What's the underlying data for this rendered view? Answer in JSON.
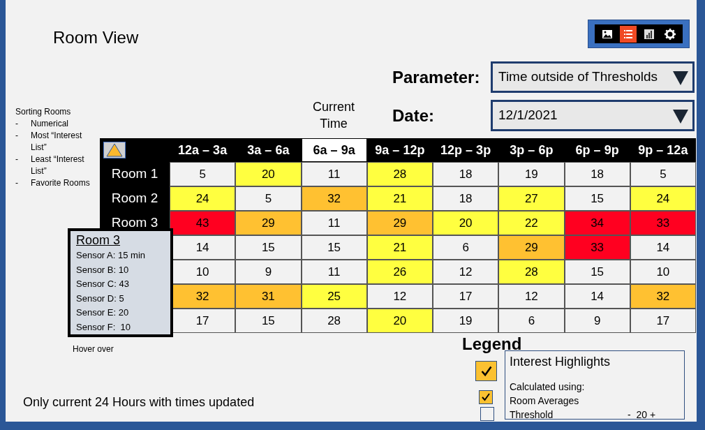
{
  "page_title": "Room View",
  "toolbar": [
    {
      "kind": "image",
      "selected": false
    },
    {
      "kind": "list",
      "selected": true
    },
    {
      "kind": "chart",
      "selected": false
    },
    {
      "kind": "settings",
      "selected": false
    }
  ],
  "parameter": {
    "label": "Parameter:",
    "value": "Time outside of Thresholds"
  },
  "date": {
    "label": "Date:",
    "value": "12/1/2021"
  },
  "current_time_label": "Current Time",
  "sorting": {
    "title": "Sorting Rooms",
    "bullet": "-",
    "options": [
      "Numerical",
      "Most “Interest List”",
      "Least “Interest List”",
      "Favorite Rooms"
    ]
  },
  "table": {
    "columns": [
      {
        "label": "12a – 3a",
        "selected": false
      },
      {
        "label": "3a – 6a",
        "selected": false
      },
      {
        "label": "6a – 9a",
        "selected": true
      },
      {
        "label": "9a – 12p",
        "selected": false
      },
      {
        "label": "12p – 3p",
        "selected": false
      },
      {
        "label": "3p – 6p",
        "selected": false
      },
      {
        "label": "6p – 9p",
        "selected": false
      },
      {
        "label": "9p – 12a",
        "selected": false
      }
    ],
    "rows": [
      {
        "label": "Room 1",
        "cells": [
          {
            "value": "5",
            "color": "#f2f2f2"
          },
          {
            "value": "20",
            "color": "#ffff40"
          },
          {
            "value": "11",
            "color": "#f2f2f2"
          },
          {
            "value": "28",
            "color": "#ffff40"
          },
          {
            "value": "18",
            "color": "#f2f2f2"
          },
          {
            "value": "19",
            "color": "#f2f2f2"
          },
          {
            "value": "18",
            "color": "#f2f2f2"
          },
          {
            "value": "5",
            "color": "#f2f2f2"
          }
        ]
      },
      {
        "label": "Room 2",
        "cells": [
          {
            "value": "24",
            "color": "#ffff40"
          },
          {
            "value": "5",
            "color": "#f2f2f2"
          },
          {
            "value": "32",
            "color": "#ffc131"
          },
          {
            "value": "21",
            "color": "#ffff40"
          },
          {
            "value": "18",
            "color": "#f2f2f2"
          },
          {
            "value": "27",
            "color": "#ffff40"
          },
          {
            "value": "15",
            "color": "#f2f2f2"
          },
          {
            "value": "24",
            "color": "#ffff40"
          }
        ]
      },
      {
        "label": "Room 3",
        "cells": [
          {
            "value": "43",
            "color": "#ff0020"
          },
          {
            "value": "29",
            "color": "#ffc131"
          },
          {
            "value": "11",
            "color": "#f2f2f2"
          },
          {
            "value": "29",
            "color": "#ffc131"
          },
          {
            "value": "20",
            "color": "#ffff40"
          },
          {
            "value": "22",
            "color": "#ffff40"
          },
          {
            "value": "34",
            "color": "#ff0020"
          },
          {
            "value": "33",
            "color": "#ff0020"
          }
        ]
      },
      {
        "cells": [
          {
            "value": "14",
            "color": "#f2f2f2"
          },
          {
            "value": "15",
            "color": "#f2f2f2"
          },
          {
            "value": "15",
            "color": "#f2f2f2"
          },
          {
            "value": "21",
            "color": "#ffff40"
          },
          {
            "value": "6",
            "color": "#f2f2f2"
          },
          {
            "value": "29",
            "color": "#ffc131"
          },
          {
            "value": "33",
            "color": "#ff0020"
          },
          {
            "value": "14",
            "color": "#f2f2f2"
          }
        ]
      },
      {
        "cells": [
          {
            "value": "10",
            "color": "#f2f2f2"
          },
          {
            "value": "9",
            "color": "#f2f2f2"
          },
          {
            "value": "11",
            "color": "#f2f2f2"
          },
          {
            "value": "26",
            "color": "#ffff40"
          },
          {
            "value": "12",
            "color": "#f2f2f2"
          },
          {
            "value": "28",
            "color": "#ffff40"
          },
          {
            "value": "15",
            "color": "#f2f2f2"
          },
          {
            "value": "10",
            "color": "#f2f2f2"
          }
        ]
      },
      {
        "cells": [
          {
            "value": "32",
            "color": "#ffc131"
          },
          {
            "value": "31",
            "color": "#ffc131"
          },
          {
            "value": "25",
            "color": "#ffff40"
          },
          {
            "value": "12",
            "color": "#f2f2f2"
          },
          {
            "value": "17",
            "color": "#f2f2f2"
          },
          {
            "value": "12",
            "color": "#f2f2f2"
          },
          {
            "value": "14",
            "color": "#f2f2f2"
          },
          {
            "value": "32",
            "color": "#ffc131"
          }
        ]
      },
      {
        "cells": [
          {
            "value": "17",
            "color": "#f2f2f2"
          },
          {
            "value": "15",
            "color": "#f2f2f2"
          },
          {
            "value": "28",
            "color": "#f2f2f2"
          },
          {
            "value": "20",
            "color": "#ffff40"
          },
          {
            "value": "19",
            "color": "#f2f2f2"
          },
          {
            "value": "6",
            "color": "#f2f2f2"
          },
          {
            "value": "9",
            "color": "#f2f2f2"
          },
          {
            "value": "17",
            "color": "#f2f2f2"
          }
        ]
      }
    ]
  },
  "tooltip": {
    "title": "Room 3",
    "lines": [
      "Sensor A: 15 min",
      "Sensor B: 10",
      "Sensor C: 43",
      "Sensor D: 5",
      "Sensor E: 20",
      "Sensor F:  10"
    ]
  },
  "hover_note": "Hover over",
  "footer_note": "Only current 24 Hours with times updated",
  "legend": {
    "title": "Legend",
    "checkboxes": [
      {
        "kind": "large",
        "checked": true
      },
      {
        "kind": "small",
        "checked": true
      },
      {
        "kind": "small",
        "checked": false
      }
    ],
    "popup": {
      "title": "Interest Highlights",
      "lines": [
        "Calculated using:",
        "Room Averages"
      ],
      "threshold_label": "Threshold",
      "threshold_value": "-  20 +"
    }
  }
}
